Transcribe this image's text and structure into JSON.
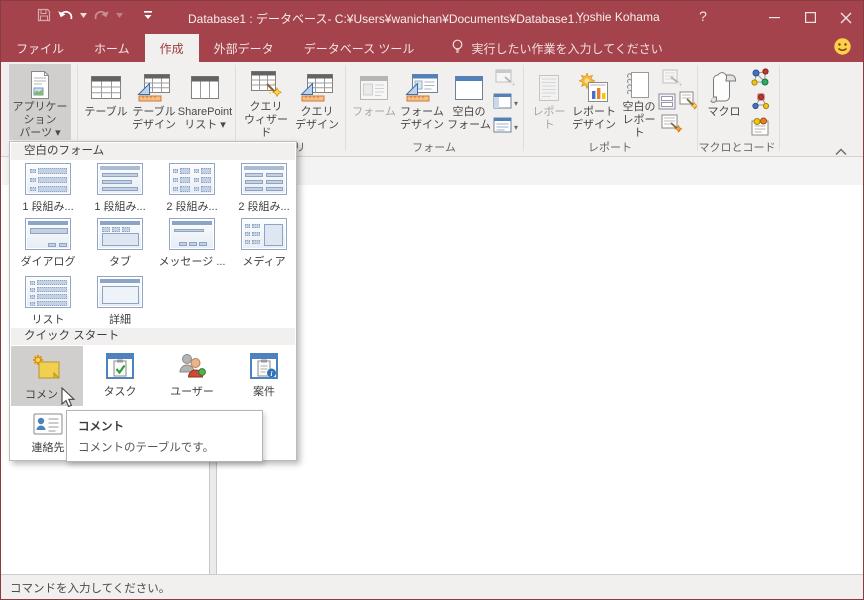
{
  "titlebar": {
    "title": "Database1 : データベース- C:¥Users¥wanichan¥Documents¥Database1…",
    "user_name": "Yoshie Kohama",
    "help_label": "?"
  },
  "tabs": {
    "file": "ファイル",
    "home": "ホーム",
    "create": "作成",
    "external": "外部データ",
    "dbtools": "データベース ツール",
    "tellme": "実行したい作業を入力してください"
  },
  "ribbon": {
    "app_parts": {
      "line1": "アプリケーション",
      "line2": "パーツ ▾"
    },
    "table": {
      "line1": "テーブル"
    },
    "table_design": {
      "line1": "テーブル",
      "line2": "デザイン"
    },
    "sharepoint_list": {
      "line1": "SharePoint",
      "line2": "リスト ▾"
    },
    "query_wizard": {
      "line1": "クエリ",
      "line2": "ウィザード"
    },
    "query_design": {
      "line1": "クエリ",
      "line2": "デザイン"
    },
    "form": {
      "line1": "フォーム"
    },
    "form_design": {
      "line1": "フォーム",
      "line2": "デザイン"
    },
    "blank_form": {
      "line1": "空白の",
      "line2": "フォーム"
    },
    "nav_caret": "▾",
    "other_caret": "▾",
    "report": {
      "line1": "レポート"
    },
    "report_design": {
      "line1": "レポート",
      "line2": "デザイン"
    },
    "blank_report": {
      "line1": "空白の",
      "line2": "レポート"
    },
    "macro": {
      "line1": "マクロ"
    },
    "groups": {
      "query": "クエリ",
      "form": "フォーム",
      "report": "レポート",
      "macro": "マクロとコード"
    }
  },
  "dropdown": {
    "sections": [
      {
        "title": "空白のフォーム",
        "items": [
          {
            "label": "1 段組み...",
            "icon": "form-1col-dotted"
          },
          {
            "label": "1 段組み...",
            "icon": "form-1col-bars"
          },
          {
            "label": "2 段組み...",
            "icon": "form-2col-dotted"
          },
          {
            "label": "2 段組み...",
            "icon": "form-2col-bars"
          },
          {
            "label": "ダイアログ",
            "icon": "dialog-form"
          },
          {
            "label": "タブ",
            "icon": "tab-form"
          },
          {
            "label": "メッセージ ...",
            "icon": "message-form"
          },
          {
            "label": "メディア",
            "icon": "media-form"
          },
          {
            "label": "リスト",
            "icon": "list-form"
          },
          {
            "label": "詳細",
            "icon": "detail-form"
          }
        ]
      },
      {
        "title": "クイック スタート",
        "items": [
          {
            "label": "コメント",
            "icon": "comment-note"
          },
          {
            "label": "タスク",
            "icon": "task-clipboard"
          },
          {
            "label": "ユーザー",
            "icon": "users"
          },
          {
            "label": "案件",
            "icon": "case-clipboard-info"
          },
          {
            "label": "連絡先",
            "icon": "contact-card"
          }
        ]
      }
    ]
  },
  "tooltip": {
    "title": "コメント",
    "desc": "コメントのテーブルです。"
  },
  "statusbar": {
    "text": "コマンドを入力してください。"
  },
  "colors": {
    "titlebar_red": "#a4434b",
    "accent_red": "#a4373a",
    "selection_gray": "#d1cfce"
  }
}
